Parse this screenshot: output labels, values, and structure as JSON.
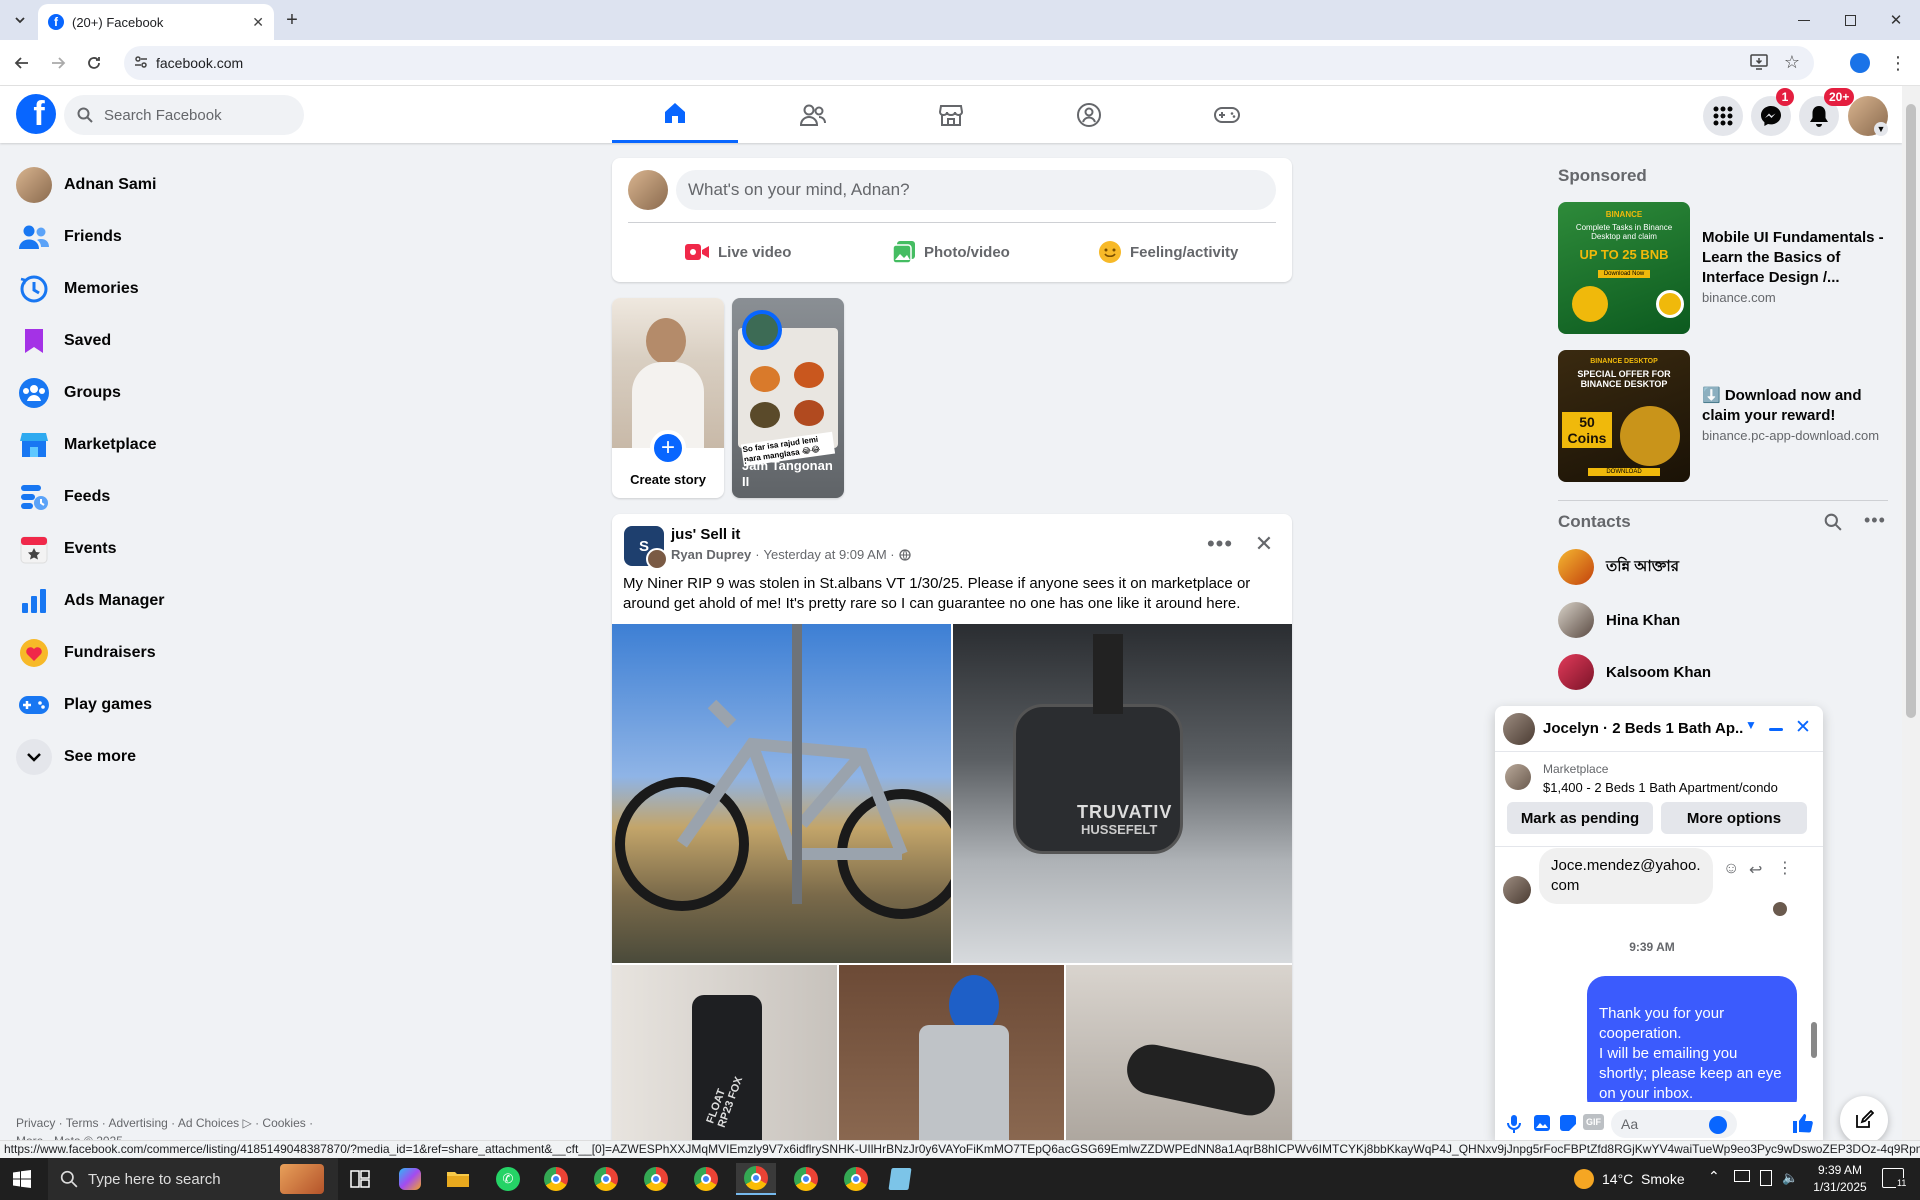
{
  "browser": {
    "tab_title": "(20+) Facebook",
    "url": "facebook.com",
    "status_url": "https://www.facebook.com/commerce/listing/4185149048387870/?media_id=1&ref=share_attachment&__cft__[0]=AZWESPhXXJMqMVIEmzly9V7x6idflrySNHK-UIlHrBNzJr0y6VAYoFiKmMO7TEpQ6acGSG69EmlwZZDWPEdNN8a1AqrB8hICPWv6IMTCYKj8bbKkayWqP4J_QHNxv9jJnpg5rFocFBPtZfd8RGjKwYV4waiTueWp9eo3Pyc9wDswoZEP3DOz-4q9RpmV..."
  },
  "fb": {
    "search_placeholder": "Search Facebook",
    "notifications_badge": "20+",
    "messenger_badge": "1"
  },
  "left_nav": {
    "items": [
      "Adnan Sami",
      "Friends",
      "Memories",
      "Saved",
      "Groups",
      "Marketplace",
      "Feeds",
      "Events",
      "Ads Manager",
      "Fundraisers",
      "Play games",
      "See more"
    ],
    "footer": "Privacy · Terms · Advertising · Ad Choices ▷ · Cookies ·",
    "footer2": "More · Meta © 2025"
  },
  "composer": {
    "placeholder": "What's on your mind, Adnan?",
    "live": "Live video",
    "photo": "Photo/video",
    "feeling": "Feeling/activity"
  },
  "stories": {
    "create": "Create story",
    "story2_name": "Jam Tangonan II",
    "story2_caption": "So far isa rajud lemi para manglasa 😂😂"
  },
  "post": {
    "group": "jus' Sell it",
    "author": "Ryan Duprey",
    "time": "Yesterday at 9:09 AM ·",
    "text": "My Niner RIP 9 was stolen in St.albans VT 1/30/25. Please if anyone sees it on marketplace or around get ahold of me! It's pretty rare so I can guarantee no one has one like it around here.",
    "brand1": "TRUVATIV",
    "brand2": "HUSSEFELT",
    "brand3": "FLOAT RP23 FOX"
  },
  "sponsored": {
    "heading": "Sponsored",
    "ads": [
      {
        "title": "Mobile UI Fundamentals - Learn the Basics of Interface Design /...",
        "domain": "binance.com",
        "img_line1": "BINANCE",
        "img_line2": "Complete Tasks in Binance Desktop and claim",
        "img_line3": "UP TO 25 BNB",
        "img_line4": "Download Now"
      },
      {
        "title": "⬇️ Download now and claim your reward!",
        "domain": "binance.pc-app-download.com",
        "img_line1": "BINANCE DESKTOP",
        "img_line2": "SPECIAL OFFER FOR BINANCE DESKTOP",
        "img_line3": "50 Coins",
        "img_line4": "DOWNLOAD"
      }
    ]
  },
  "contacts": {
    "heading": "Contacts",
    "items": [
      "তন্নি আক্তার",
      "Hina Khan",
      "Kalsoom Khan"
    ]
  },
  "chat": {
    "title": "Jocelyn · 2 Beds 1 Bath Ap...",
    "listing_source": "Marketplace",
    "listing_title": "$1,400 - 2 Beds 1 Bath Apartment/condo",
    "mark_pending": "Mark as pending",
    "more_options": "More options",
    "incoming": "Joce.mendez@yahoo.com",
    "timestamp": "9:39 AM",
    "outgoing": "Thank you for your cooperation.\nI will be emailing you shortly; please keep an eye on your inbox.",
    "input_placeholder": "Aa"
  },
  "taskbar": {
    "search_placeholder": "Type here to search",
    "weather": "14°C  Smoke",
    "time": "9:39 AM",
    "date": "1/31/2025",
    "notif_count": "11"
  },
  "colors": {
    "fb_blue": "#0866ff",
    "messenger": "#0a7cff",
    "badge": "#e41e3f"
  }
}
